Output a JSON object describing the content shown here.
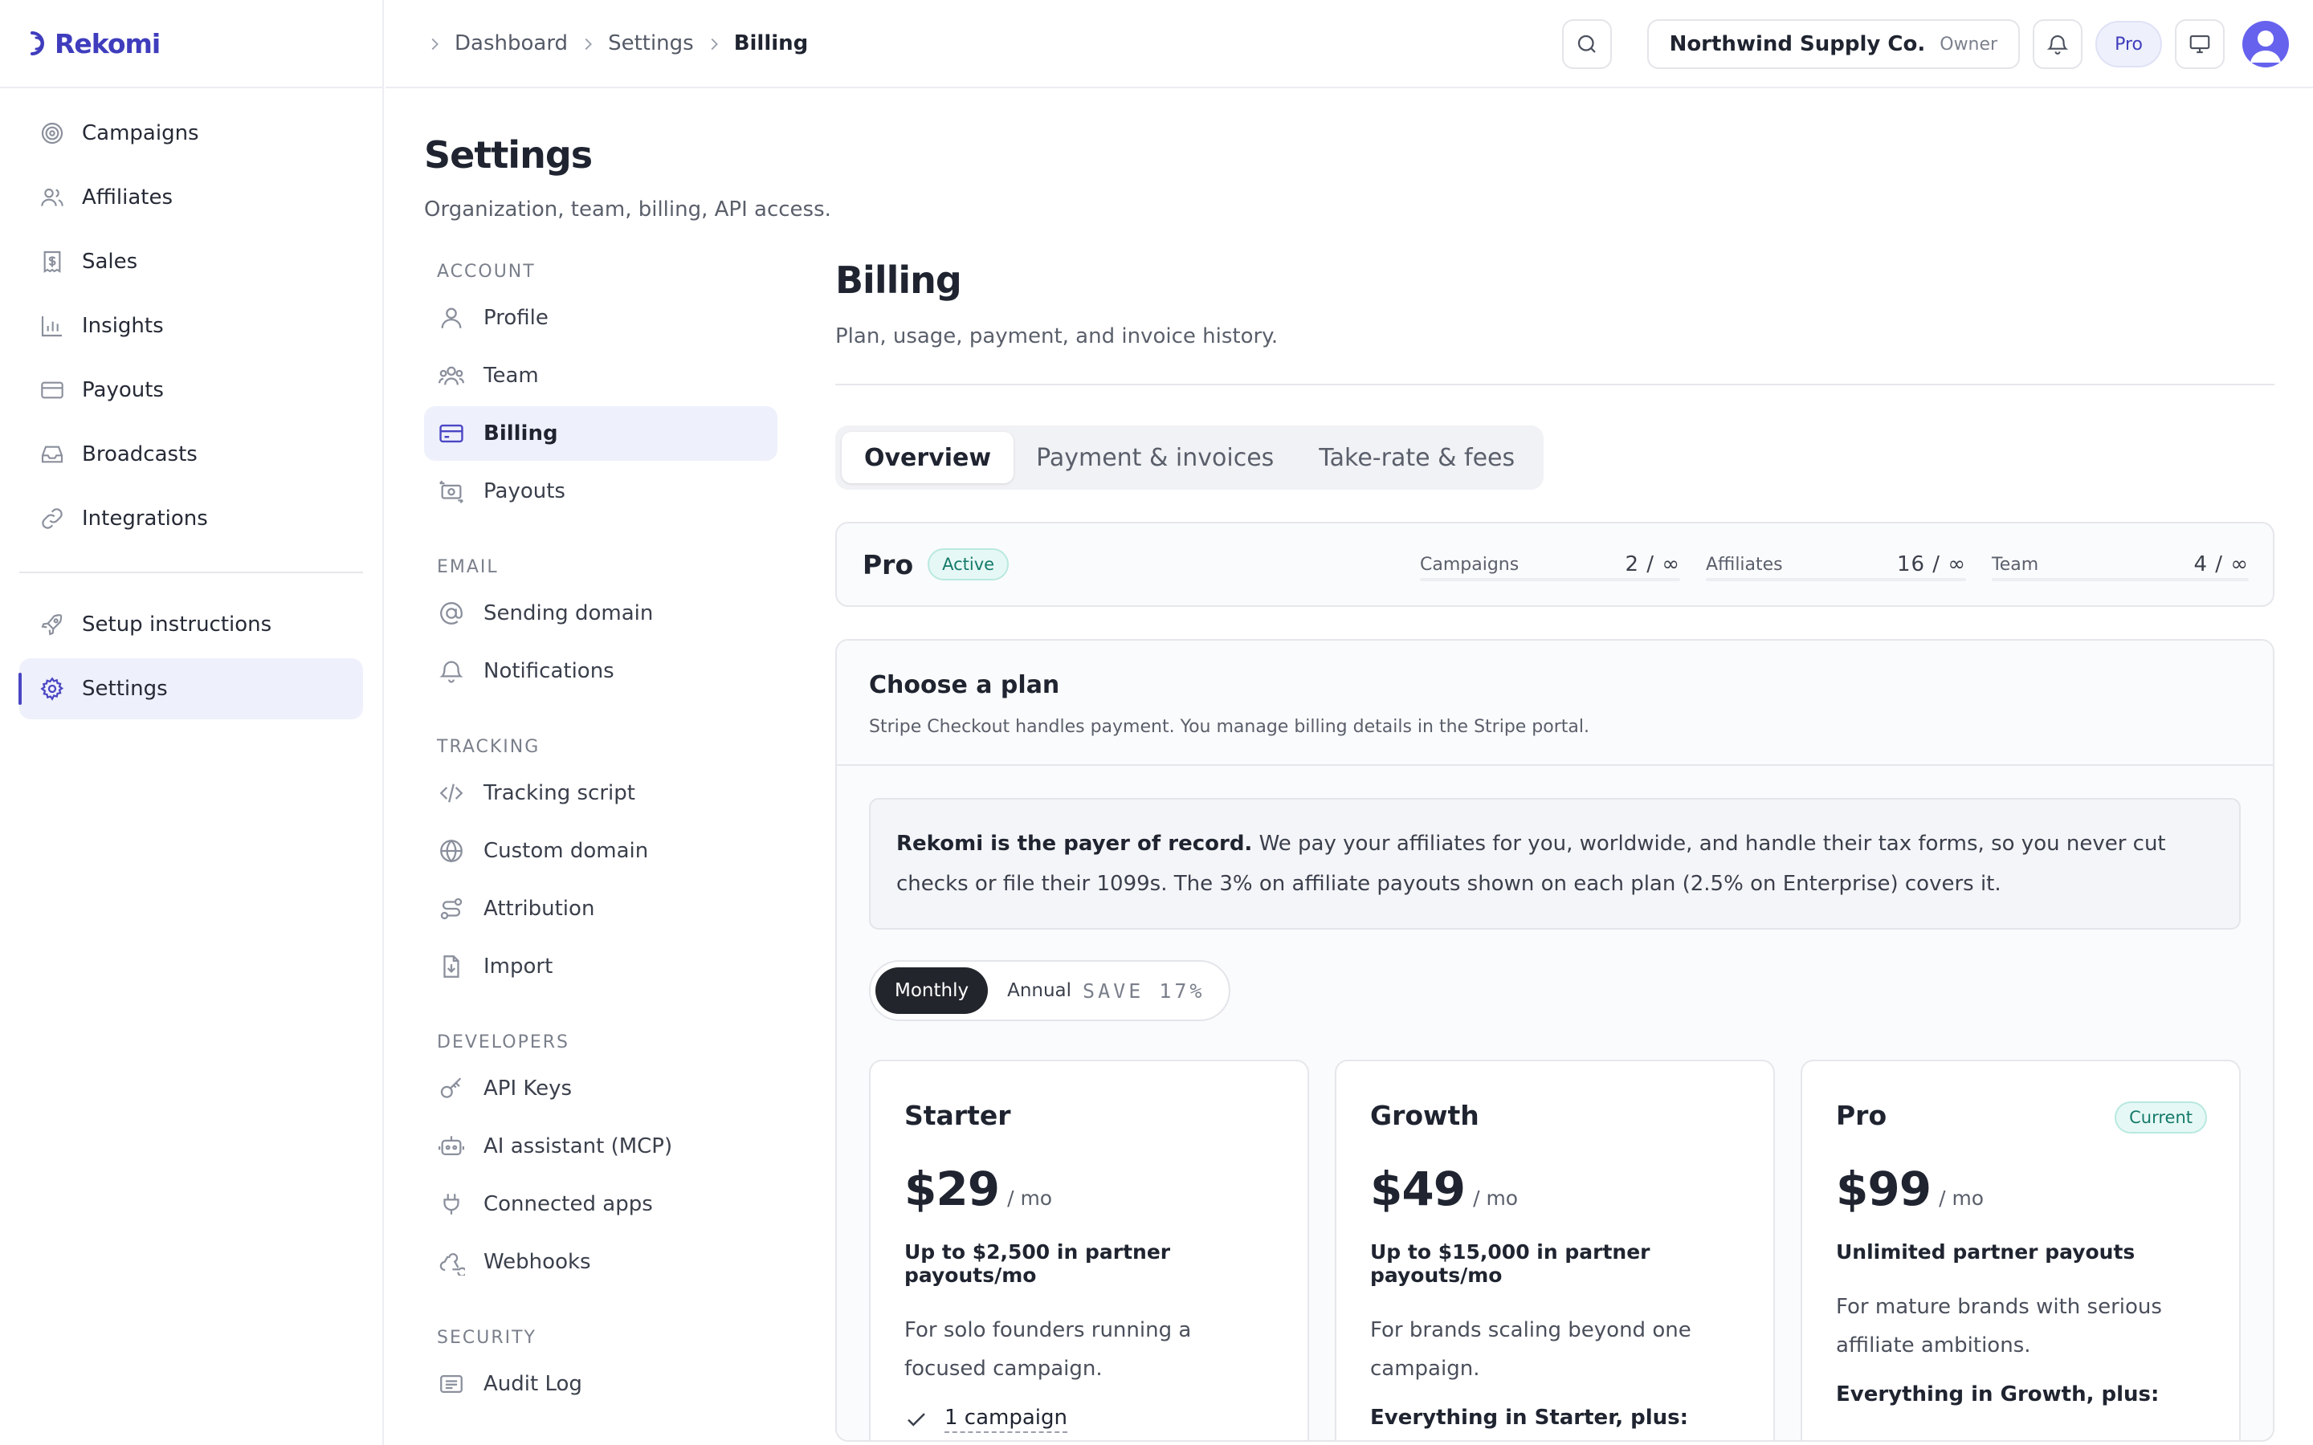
{
  "brand": {
    "name": "Rekomi"
  },
  "sidebar": {
    "items": [
      {
        "label": "Campaigns",
        "icon": "target-icon"
      },
      {
        "label": "Affiliates",
        "icon": "users-icon"
      },
      {
        "label": "Sales",
        "icon": "receipt-icon"
      },
      {
        "label": "Insights",
        "icon": "bar-chart-icon"
      },
      {
        "label": "Payouts",
        "icon": "card-icon"
      },
      {
        "label": "Broadcasts",
        "icon": "inbox-icon"
      },
      {
        "label": "Integrations",
        "icon": "link-icon"
      }
    ],
    "secondary": [
      {
        "label": "Setup instructions",
        "icon": "rocket-icon"
      },
      {
        "label": "Settings",
        "icon": "gear-icon",
        "active": true
      }
    ]
  },
  "breadcrumb": [
    "Dashboard",
    "Settings",
    "Billing"
  ],
  "topbar": {
    "org_name": "Northwind Supply Co.",
    "org_role": "Owner",
    "plan_pill": "Pro"
  },
  "settings": {
    "title": "Settings",
    "subtitle": "Organization, team, billing, API access.",
    "sections": [
      {
        "title": "ACCOUNT",
        "items": [
          "Profile",
          "Team",
          "Billing",
          "Payouts"
        ]
      },
      {
        "title": "EMAIL",
        "items": [
          "Sending domain",
          "Notifications"
        ]
      },
      {
        "title": "TRACKING",
        "items": [
          "Tracking script",
          "Custom domain",
          "Attribution",
          "Import"
        ]
      },
      {
        "title": "DEVELOPERS",
        "items": [
          "API Keys",
          "AI assistant (MCP)",
          "Connected apps",
          "Webhooks"
        ]
      },
      {
        "title": "SECURITY",
        "items": [
          "Audit Log"
        ]
      }
    ],
    "active_item": "Billing"
  },
  "billing": {
    "title": "Billing",
    "subtitle": "Plan, usage, payment, and invoice history.",
    "tabs": [
      "Overview",
      "Payment & invoices",
      "Take-rate & fees"
    ],
    "active_tab": "Overview",
    "current_plan": {
      "name": "Pro",
      "status": "Active",
      "usage": [
        {
          "label": "Campaigns",
          "used": "2",
          "limit": "∞"
        },
        {
          "label": "Affiliates",
          "used": "16",
          "limit": "∞"
        },
        {
          "label": "Team",
          "used": "4",
          "limit": "∞"
        }
      ]
    },
    "choose": {
      "title": "Choose a plan",
      "subtitle": "Stripe Checkout handles payment. You manage billing details in the Stripe portal.",
      "notice_bold": "Rekomi is the payer of record.",
      "notice_text": " We pay your affiliates for you, worldwide, and handle their tax forms, so you never cut checks or file their 1099s. The 3% on affiliate payouts shown on each plan (2.5% on Enterprise) covers it.",
      "toggle": {
        "monthly": "Monthly",
        "annual": "Annual",
        "save": "SAVE 17%"
      },
      "plans": [
        {
          "name": "Starter",
          "price": "$29",
          "per": "/ mo",
          "cap": "Up to $2,500 in partner payouts/mo",
          "desc": "For solo founders running a focused campaign.",
          "feature": "1 campaign"
        },
        {
          "name": "Growth",
          "price": "$49",
          "per": "/ mo",
          "cap": "Up to $15,000 in partner payouts/mo",
          "desc": "For brands scaling beyond one campaign.",
          "plus": "Everything in Starter, plus:"
        },
        {
          "name": "Pro",
          "price": "$99",
          "per": "/ mo",
          "cap": "Unlimited partner payouts",
          "desc": "For mature brands with serious affiliate ambitions.",
          "plus": "Everything in Growth, plus:",
          "badge": "Current"
        }
      ]
    }
  },
  "colors": {
    "accent": "#4a46c4",
    "success": "#147a6a",
    "avatar": "#6662ee"
  }
}
